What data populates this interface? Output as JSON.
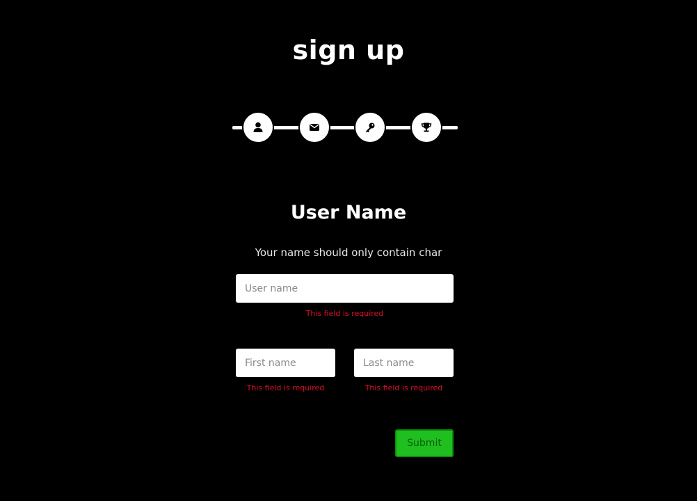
{
  "page": {
    "title": "sign up"
  },
  "stepper": {
    "steps": [
      {
        "icon": "user-icon"
      },
      {
        "icon": "envelope-icon"
      },
      {
        "icon": "key-icon"
      },
      {
        "icon": "trophy-icon"
      }
    ]
  },
  "section": {
    "title": "User Name",
    "subtitle": "Your name should only contain char"
  },
  "form": {
    "username": {
      "placeholder": "User name",
      "value": "",
      "error": "This field is required"
    },
    "first_name": {
      "placeholder": "First name",
      "value": "",
      "error": "This field is required"
    },
    "last_name": {
      "placeholder": "Last name",
      "value": "",
      "error": "This field is required"
    },
    "submit_label": "Submit"
  },
  "colors": {
    "background": "#000000",
    "error": "#e0102a",
    "submit": "#1fbf1f"
  }
}
